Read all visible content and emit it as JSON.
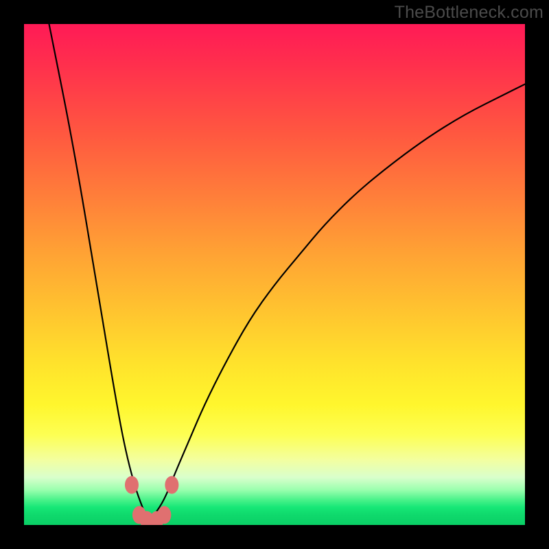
{
  "watermark": "TheBottleneck.com",
  "colors": {
    "frame": "#000000",
    "curve_stroke": "#000000",
    "marker_fill": "#e07070",
    "marker_stroke": "#c85a5a",
    "gradient_top": "#ff1a56",
    "gradient_bottom": "#0ad066"
  },
  "chart_data": {
    "type": "line",
    "title": "",
    "xlabel": "",
    "ylabel": "",
    "xlim": [
      0,
      100
    ],
    "ylim": [
      0,
      100
    ],
    "grid": false,
    "legend": false,
    "description": "Bottleneck curve: single V-shaped curve on a red-to-green vertical gradient. Y axis runs top (100 = worst / red) to bottom (0 = best / green). Minimum near x≈25, y≈0. Six salmon-colored elliptical markers cluster around the minimum.",
    "series": [
      {
        "name": "bottleneck-curve",
        "x": [
          5,
          10,
          15,
          18,
          20,
          22,
          24,
          25,
          26,
          28,
          30,
          33,
          36,
          40,
          45,
          50,
          55,
          60,
          66,
          72,
          80,
          88,
          96,
          100
        ],
        "y_top0": [
          100,
          75,
          45,
          27,
          16,
          8,
          2.5,
          1,
          2,
          5,
          10,
          17,
          24,
          32,
          41,
          48,
          54,
          60,
          66,
          71,
          77,
          82,
          86,
          88
        ]
      }
    ],
    "markers": [
      {
        "x": 21.5,
        "y_top0": 8.0
      },
      {
        "x": 23.0,
        "y_top0": 2.0
      },
      {
        "x": 24.5,
        "y_top0": 1.0
      },
      {
        "x": 26.5,
        "y_top0": 1.0
      },
      {
        "x": 28.0,
        "y_top0": 2.0
      },
      {
        "x": 29.5,
        "y_top0": 8.0
      }
    ],
    "note": "y_top0 is measured with 0 at the BOTTOM (green) and 100 at the TOP (red), matching the visual gradient. Values are read off the figure and approximate."
  }
}
